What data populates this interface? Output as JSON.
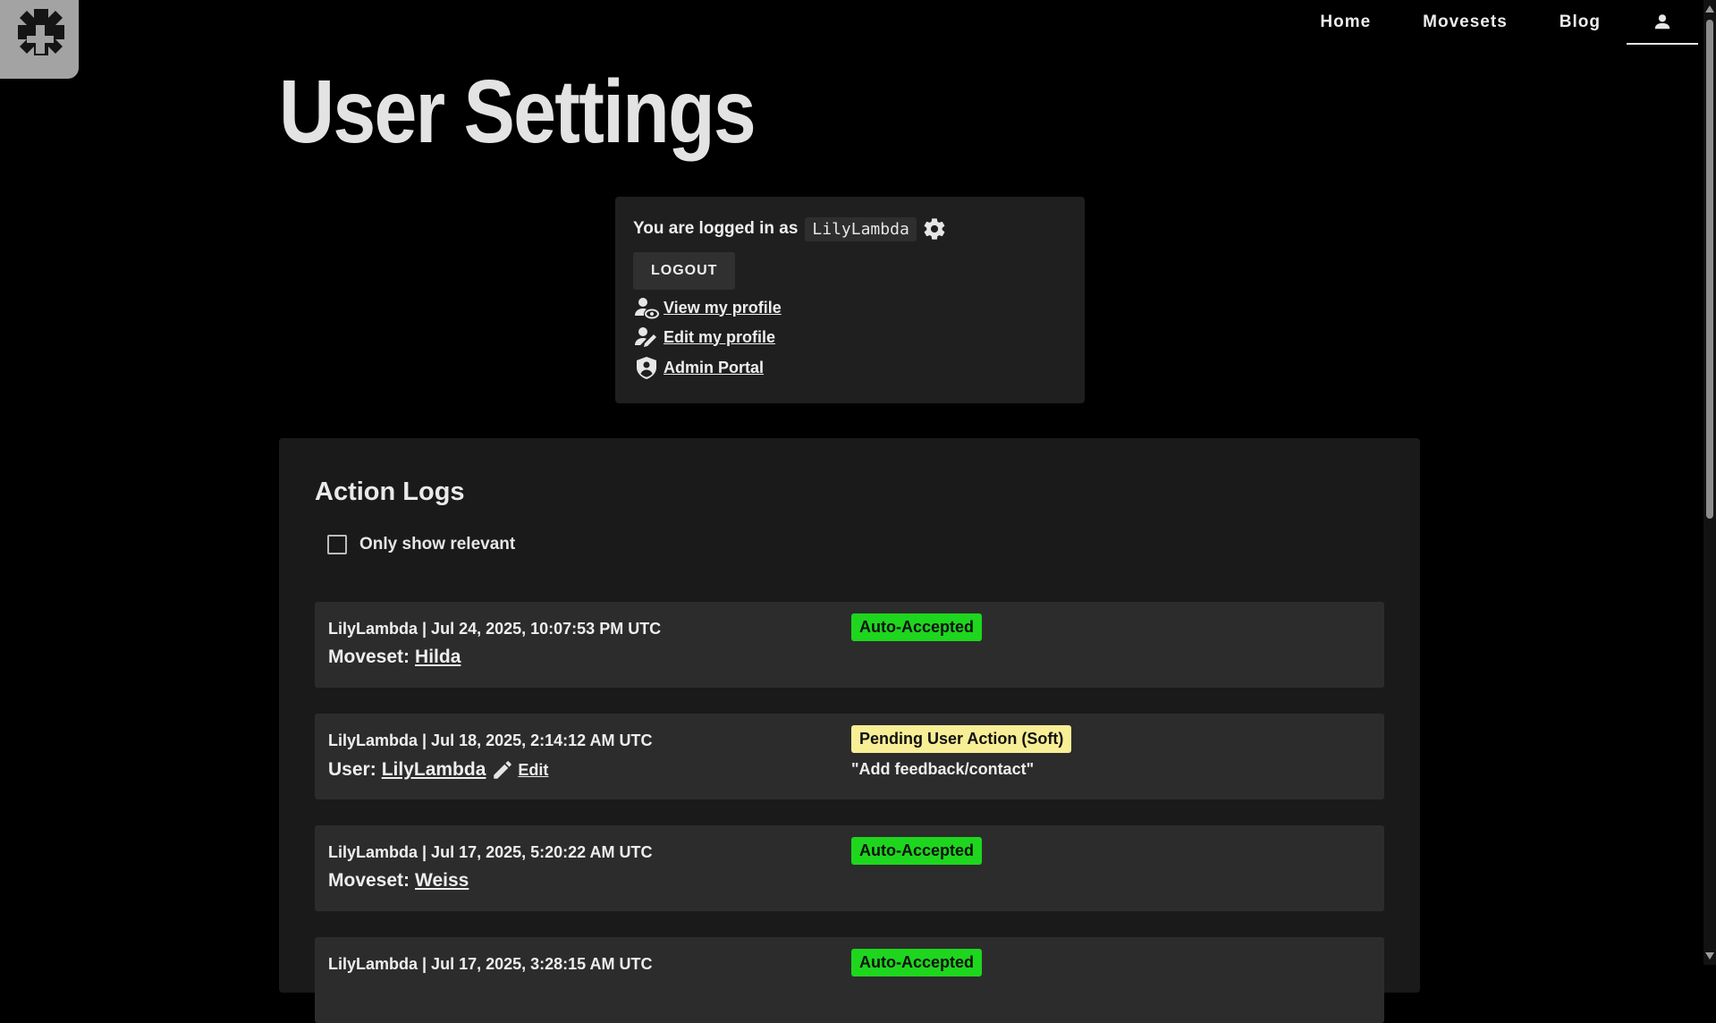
{
  "nav": {
    "home": "Home",
    "movesets": "Movesets",
    "blog": "Blog",
    "user_icon": "user-icon"
  },
  "page_title": "User Settings",
  "login": {
    "logged_in_label": "You are logged in as",
    "username": "LilyLambda",
    "logout_label": "LOGOUT",
    "links": [
      {
        "label": "View my profile",
        "icon": "view-profile-icon"
      },
      {
        "label": "Edit my profile",
        "icon": "edit-profile-icon"
      },
      {
        "label": "Admin Portal",
        "icon": "shield-icon"
      }
    ]
  },
  "action_logs": {
    "title": "Action Logs",
    "only_relevant_label": "Only show relevant",
    "only_relevant_checked": false,
    "entries": [
      {
        "meta": "LilyLambda | Jul 24, 2025, 10:07:53 PM UTC",
        "target_type": "Moveset:",
        "target_name": "Hilda",
        "status": "Auto-Accepted",
        "status_color": "#1ed61e"
      },
      {
        "meta": "LilyLambda | Jul 18, 2025, 2:14:12 AM UTC",
        "target_type": "User:",
        "target_name": "LilyLambda",
        "edit_label": "Edit",
        "status": "Pending User Action (Soft)",
        "status_color": "#f8ee95",
        "note": "\"Add feedback/contact\""
      },
      {
        "meta": "LilyLambda | Jul 17, 2025, 5:20:22 AM UTC",
        "target_type": "Moveset:",
        "target_name": "Weiss",
        "status": "Auto-Accepted",
        "status_color": "#1ed61e"
      },
      {
        "meta": "LilyLambda | Jul 17, 2025, 3:28:15 AM UTC",
        "status": "Auto-Accepted",
        "status_color": "#1ed61e"
      }
    ]
  },
  "colors": {
    "background": "#000000",
    "panel": "#1a1a1a",
    "entry": "#2c2c2c",
    "accepted": "#1ed61e",
    "pending": "#f8ee95"
  }
}
